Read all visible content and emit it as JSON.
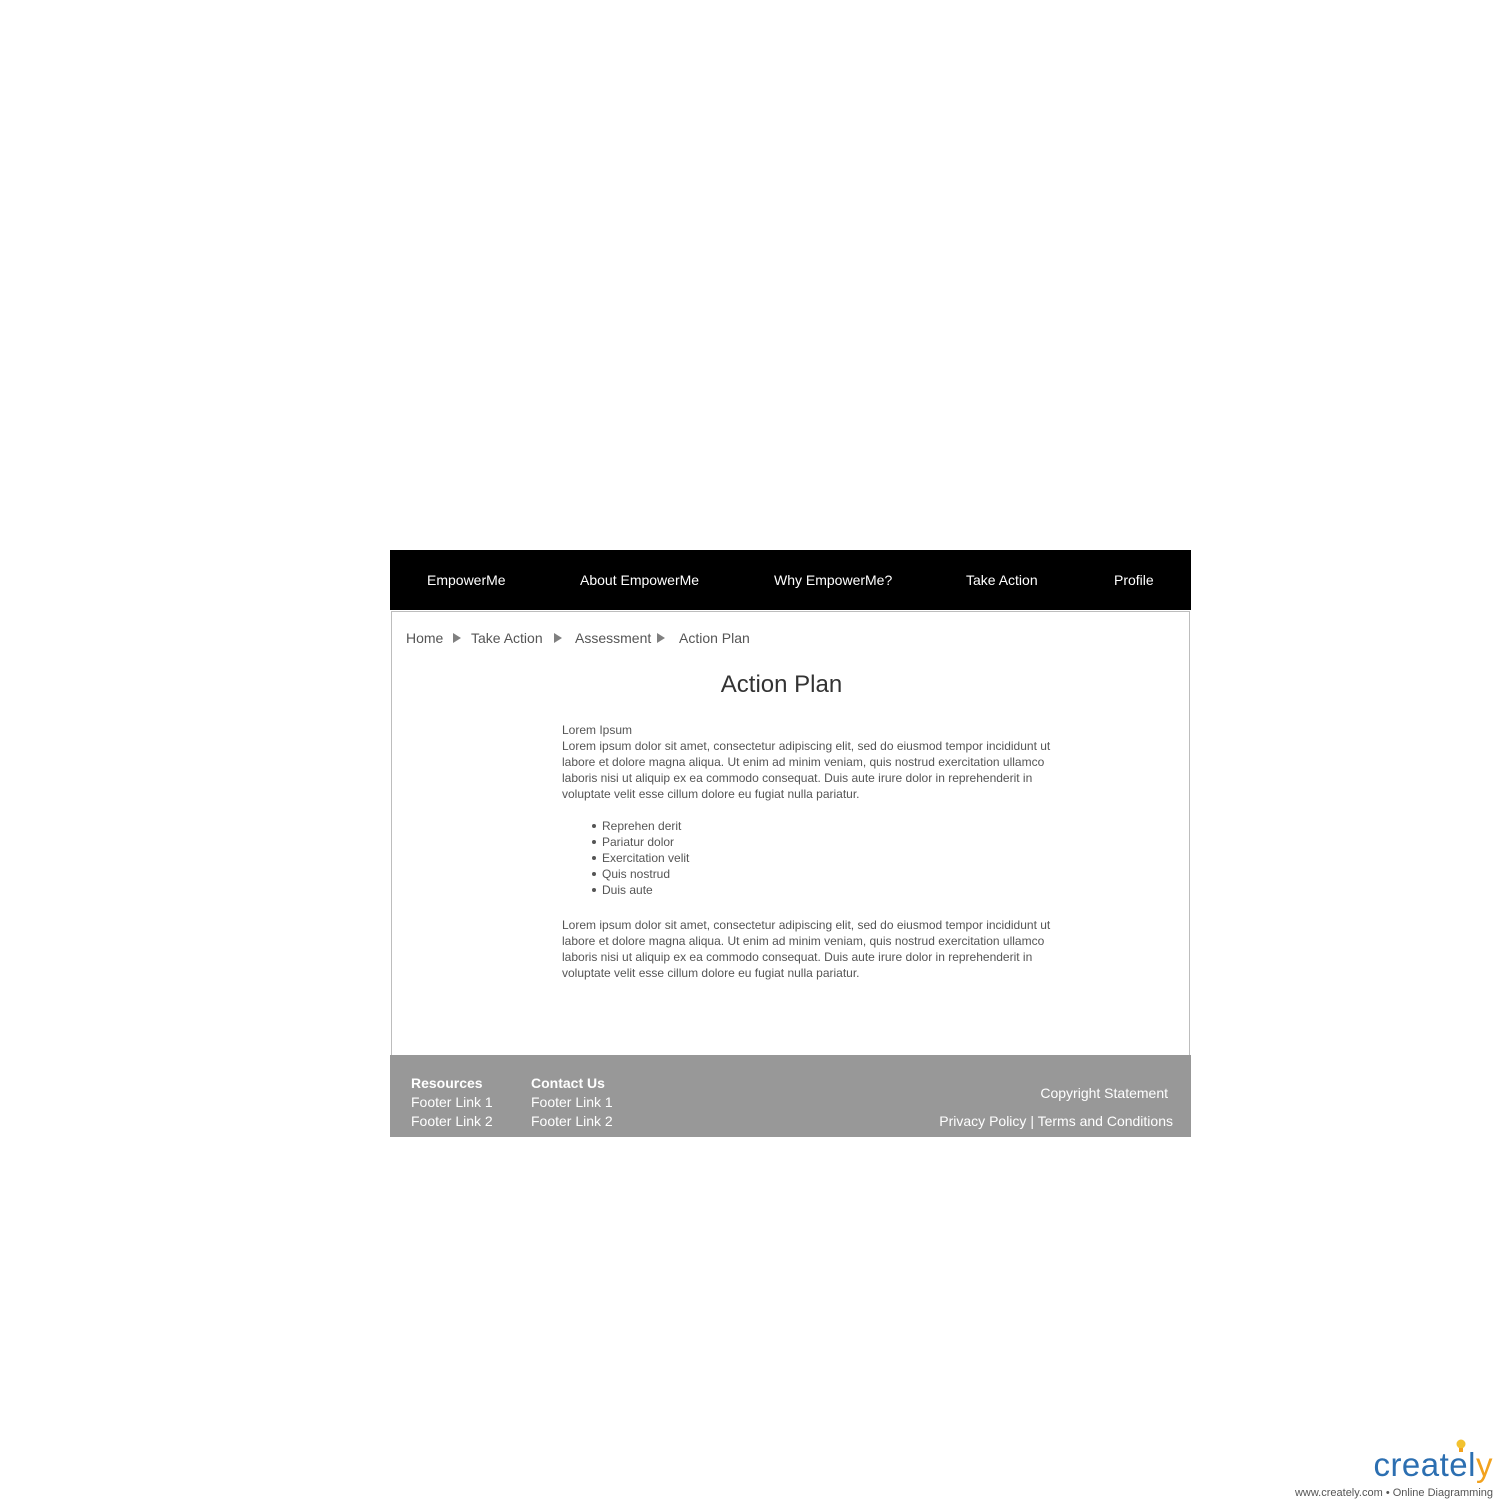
{
  "nav": {
    "items": [
      {
        "label": "EmpowerMe"
      },
      {
        "label": "About EmpowerMe"
      },
      {
        "label": "Why EmpowerMe?"
      },
      {
        "label": "Take Action"
      },
      {
        "label": "Profile"
      }
    ]
  },
  "breadcrumb": {
    "items": [
      {
        "label": "Home"
      },
      {
        "label": "Take Action"
      },
      {
        "label": "Assessment"
      },
      {
        "label": "Action Plan"
      }
    ],
    "separator_icon": "triangle-right-icon"
  },
  "main": {
    "title": "Action Plan",
    "lead_title": "Lorem Ipsum",
    "paragraph1": "Lorem ipsum dolor sit amet, consectetur adipiscing elit, sed do eiusmod tempor incididunt ut labore et dolore magna aliqua. Ut enim ad minim veniam, quis nostrud exercitation ullamco laboris nisi ut aliquip ex ea commodo consequat. Duis aute irure dolor in reprehenderit in voluptate velit esse cillum dolore eu fugiat nulla pariatur.",
    "bullets": [
      "Reprehen derit",
      "Pariatur dolor",
      "Exercitation velit",
      "Quis nostrud",
      "Duis aute"
    ],
    "paragraph2": "Lorem ipsum dolor sit amet, consectetur adipiscing elit, sed do eiusmod tempor incididunt ut labore et dolore magna aliqua. Ut enim ad minim veniam, quis nostrud exercitation ullamco laboris nisi ut aliquip ex ea commodo consequat. Duis aute irure dolor in reprehenderit in voluptate velit esse cillum dolore eu fugiat nulla pariatur."
  },
  "footer": {
    "resources": {
      "heading": "Resources",
      "links": [
        "Footer Link 1",
        "Footer Link 2"
      ]
    },
    "contact": {
      "heading": "Contact Us",
      "links": [
        "Footer Link 1",
        "Footer Link 2"
      ]
    },
    "copyright": "Copyright Statement",
    "privacy": "Privacy Policy",
    "separator": "|",
    "terms": "Terms and Conditions"
  },
  "watermark": {
    "logo_main": "createl",
    "logo_accent": "y",
    "tagline": "www.creately.com • Online Diagramming",
    "icon": "lightbulb-icon"
  },
  "colors": {
    "nav_bg": "#000000",
    "footer_bg": "#989898",
    "brand_blue": "#2c6fb1",
    "brand_orange": "#f2a21e"
  }
}
